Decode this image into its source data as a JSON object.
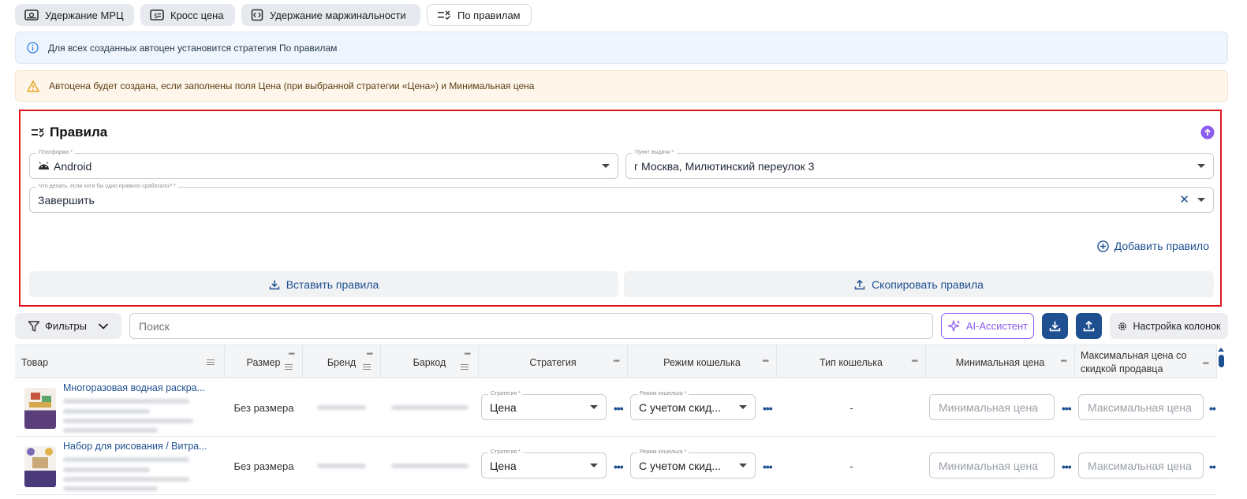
{
  "tabs": [
    {
      "label": "Удержание МРЦ",
      "icon": "cash-icon"
    },
    {
      "label": "Кросс цена",
      "icon": "dollar-tag-icon"
    },
    {
      "label": "Удержание маржинальности",
      "icon": "code-box-icon"
    },
    {
      "label": "По правилам",
      "icon": "rules-icon"
    }
  ],
  "banners": {
    "info": "Для всех созданных автоцен установится стратегия По правилам",
    "warning": "Автоцена будет создана, если заполнены поля Цена (при выбранной стратегии «Цена») и Минимальная цена"
  },
  "rules_panel": {
    "title": "Правила",
    "platform": {
      "label": "Платформа *",
      "value": "Android"
    },
    "pickup": {
      "label": "Пункт выдачи *",
      "value": "г Москва, Милютинский переулок 3"
    },
    "action": {
      "label": "Что делать, если хотя бы одно правило сработало? *",
      "value": "Завершить"
    },
    "add_rule": "Добавить правило",
    "paste_rules": "Вставить правила",
    "copy_rules": "Скопировать правила"
  },
  "toolbar": {
    "filters": "Фильтры",
    "search_placeholder": "Поиск",
    "ai_assistant": "AI-Ассистент",
    "columns_settings": "Настройка колонок"
  },
  "table": {
    "columns": [
      "Товар",
      "Размер",
      "Бренд",
      "Баркод",
      "Стратегия",
      "Режим кошелька",
      "Тип кошелька",
      "Минимальная цена",
      "Максимальная цена со скидкой продавца"
    ],
    "rows": [
      {
        "name": "Многоразовая водная раскра...",
        "size": "Без размера",
        "strategy_label": "Стратегия *",
        "strategy": "Цена",
        "wallet_mode_label": "Режим кошелька *",
        "wallet_mode": "С учетом скид...",
        "wallet_type": "-",
        "min_price_placeholder": "Минимальная цена",
        "max_price_placeholder": "Максимальная цена"
      },
      {
        "name": "Набор для рисования / Витра...",
        "size": "Без размера",
        "strategy_label": "Стратегия *",
        "strategy": "Цена",
        "wallet_mode_label": "Режим кошелька *",
        "wallet_mode": "С учетом скид...",
        "wallet_type": "-",
        "min_price_placeholder": "Минимальная цена",
        "max_price_placeholder": "Максимальная цена"
      }
    ]
  },
  "colors": {
    "accent_blue": "#1d4f91",
    "highlight_red": "#e0141b",
    "ai_purple": "#8a5cf0"
  }
}
